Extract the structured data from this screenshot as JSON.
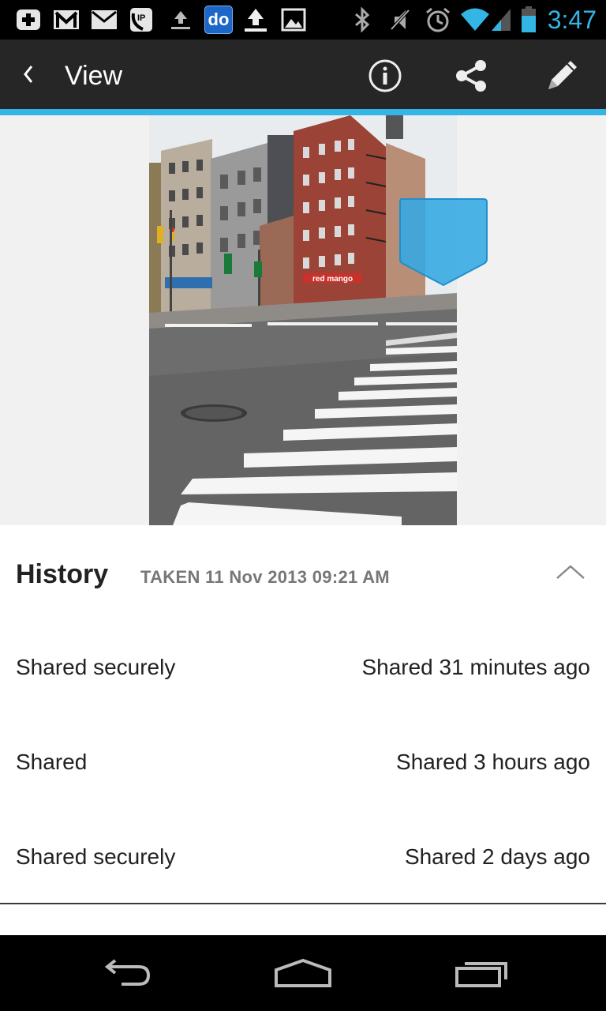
{
  "status_bar": {
    "time": "3:47",
    "icons": [
      "add-notification-icon",
      "gmail-icon",
      "email-icon",
      "voicemail-icon",
      "upload-icon",
      "app-do-icon",
      "upload-complete-icon",
      "image-icon",
      "bluetooth-icon",
      "mute-icon",
      "alarm-icon",
      "wifi-icon",
      "signal-icon",
      "battery-icon"
    ],
    "app_badge_text": "do",
    "accent_color": "#33b5e5"
  },
  "action_bar": {
    "title": "View",
    "actions": [
      "info-icon",
      "share-icon",
      "edit-pencil-icon"
    ]
  },
  "photo": {
    "description_icon": "street-photo",
    "storefront_sign": "red mango"
  },
  "history": {
    "title": "History",
    "taken": "TAKEN 11 Nov 2013 09:21 AM",
    "items": [
      {
        "label": "Shared securely",
        "time": "Shared 31 minutes ago"
      },
      {
        "label": "Shared",
        "time": "Shared 3 hours ago"
      },
      {
        "label": "Shared securely",
        "time": "Shared 2 days ago"
      }
    ]
  },
  "nav_bar": {
    "buttons": [
      "back-icon",
      "home-icon",
      "recent-apps-icon"
    ]
  }
}
